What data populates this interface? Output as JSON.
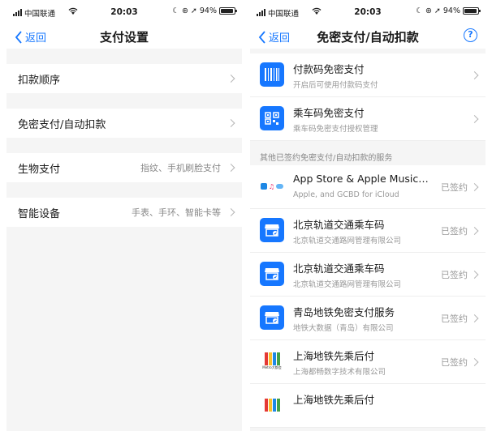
{
  "status": {
    "carrier": "中国联通",
    "time": "20:03",
    "battery": "94%",
    "battery_level": 0.94
  },
  "left": {
    "back_label": "返回",
    "title": "支付设置",
    "rows": [
      {
        "label": "扣款顺序",
        "hint": ""
      },
      {
        "label": "免密支付/自动扣款",
        "hint": ""
      },
      {
        "label": "生物支付",
        "hint": "指纹、手机刷脸支付"
      },
      {
        "label": "智能设备",
        "hint": "手表、手环、智能卡等"
      }
    ]
  },
  "right": {
    "back_label": "返回",
    "title": "免密支付/自动扣款",
    "help": "?",
    "top_items": [
      {
        "title": "付款码免密支付",
        "subtitle": "开启后可使用付款码支付",
        "icon": "barcode-icon"
      },
      {
        "title": "乘车码免密支付",
        "subtitle": "乘车码免密支付授权管理",
        "icon": "qrcode-icon"
      }
    ],
    "section_label": "其他已签约免密支付/自动扣款的服务",
    "services": [
      {
        "title": "App Store & Apple Music…",
        "subtitle": "Apple, and GCBD for iCloud",
        "status": "已签约",
        "icon": "apple-services-icon"
      },
      {
        "title": "北京轨道交通乘车码",
        "subtitle": "北京轨道交通路网管理有限公司",
        "status": "已签约",
        "icon": "transit-icon"
      },
      {
        "title": "北京轨道交通乘车码",
        "subtitle": "北京轨道交通路网管理有限公司",
        "status": "已签约",
        "icon": "transit-icon"
      },
      {
        "title": "青岛地铁免密支付服务",
        "subtitle": "地铁大数据（青岛）有限公司",
        "status": "已签约",
        "icon": "transit-icon"
      },
      {
        "title": "上海地铁先乘后付",
        "subtitle": "上海都畅数字技术有限公司",
        "status": "已签约",
        "icon": "metro-pay-icon"
      },
      {
        "title": "上海地铁先乘后付",
        "subtitle": "",
        "status": "",
        "icon": "metro-pay-icon"
      }
    ],
    "metro_logo_text": "Metro大都会"
  }
}
